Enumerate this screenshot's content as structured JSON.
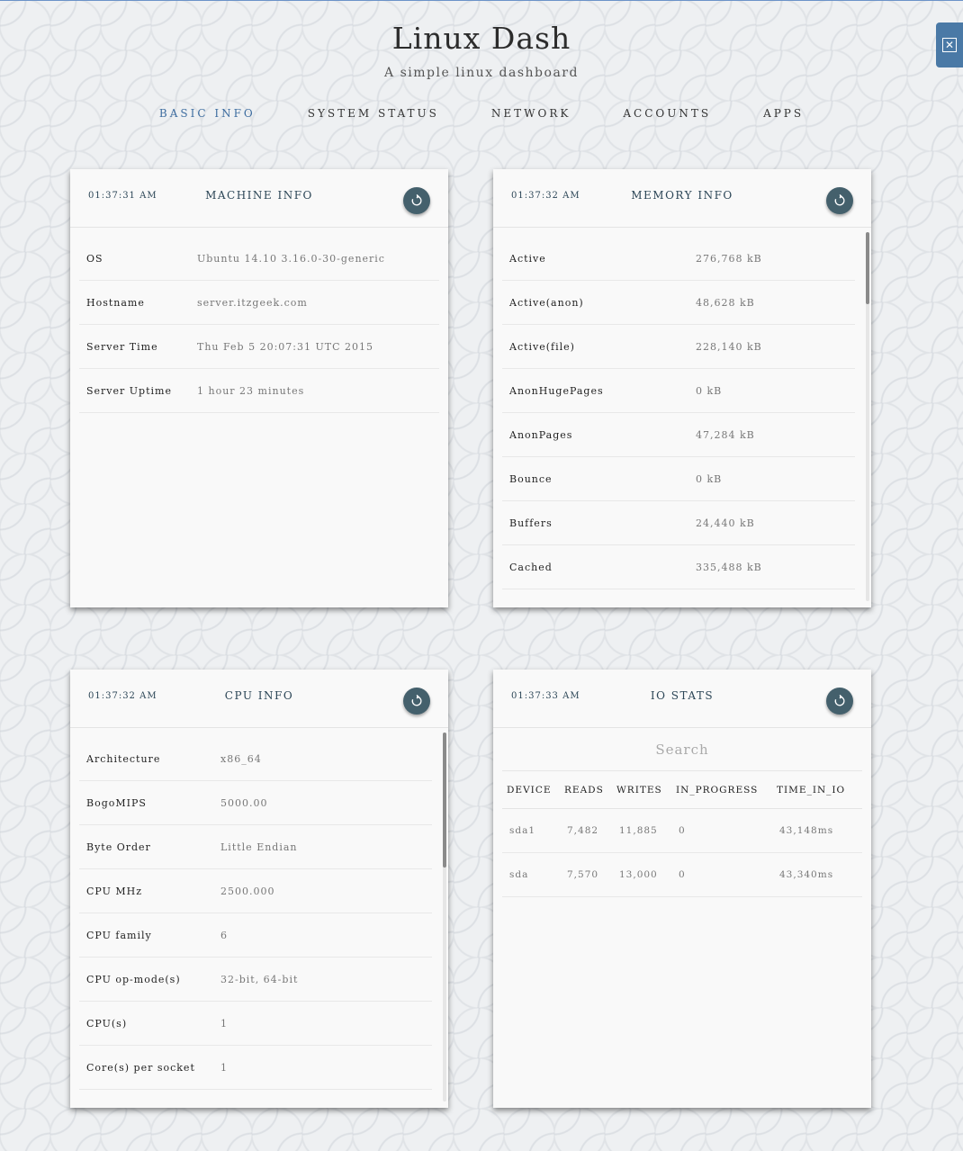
{
  "header": {
    "title": "Linux Dash",
    "subtitle": "A simple linux dashboard"
  },
  "nav": [
    {
      "label": "BASIC INFO",
      "active": true
    },
    {
      "label": "SYSTEM STATUS",
      "active": false
    },
    {
      "label": "NETWORK",
      "active": false
    },
    {
      "label": "ACCOUNTS",
      "active": false
    },
    {
      "label": "APPS",
      "active": false
    }
  ],
  "close_tab": {
    "icon": "close-icon",
    "glyph": "✕"
  },
  "colors": {
    "accent": "#3e6da0",
    "refresh_button": "#44606c",
    "close_tab": "#4a79a6"
  },
  "machine_info": {
    "time": "01:37:31 AM",
    "title": "MACHINE INFO",
    "refresh_icon": "refresh-icon",
    "rows": [
      {
        "key": "OS",
        "value": "Ubuntu 14.10 3.16.0-30-generic"
      },
      {
        "key": "Hostname",
        "value": "server.itzgeek.com"
      },
      {
        "key": "Server Time",
        "value": "Thu Feb 5 20:07:31 UTC 2015"
      },
      {
        "key": "Server Uptime",
        "value": "1 hour 23 minutes"
      }
    ]
  },
  "memory_info": {
    "time": "01:37:32 AM",
    "title": "MEMORY INFO",
    "refresh_icon": "refresh-icon",
    "rows": [
      {
        "key": "Active",
        "value": "276,768 kB"
      },
      {
        "key": "Active(anon)",
        "value": "48,628 kB"
      },
      {
        "key": "Active(file)",
        "value": "228,140 kB"
      },
      {
        "key": "AnonHugePages",
        "value": "0 kB"
      },
      {
        "key": "AnonPages",
        "value": "47,284 kB"
      },
      {
        "key": "Bounce",
        "value": "0 kB"
      },
      {
        "key": "Buffers",
        "value": "24,440 kB"
      },
      {
        "key": "Cached",
        "value": "335,488 kB"
      }
    ]
  },
  "cpu_info": {
    "time": "01:37:32 AM",
    "title": "CPU INFO",
    "refresh_icon": "refresh-icon",
    "rows": [
      {
        "key": "Architecture",
        "value": "x86_64"
      },
      {
        "key": "BogoMIPS",
        "value": "5000.00"
      },
      {
        "key": "Byte Order",
        "value": "Little Endian"
      },
      {
        "key": "CPU MHz",
        "value": "2500.000"
      },
      {
        "key": "CPU family",
        "value": "6"
      },
      {
        "key": "CPU op-mode(s)",
        "value": "32-bit, 64-bit"
      },
      {
        "key": "CPU(s)",
        "value": "1"
      },
      {
        "key": "Core(s) per socket",
        "value": "1"
      }
    ]
  },
  "io_stats": {
    "time": "01:37:33 AM",
    "title": "IO STATS",
    "refresh_icon": "refresh-icon",
    "search_placeholder": "Search",
    "columns": [
      "DEVICE",
      "READS",
      "WRITES",
      "IN_PROGRESS",
      "TIME_IN_IO"
    ],
    "rows": [
      [
        "sda1",
        "7,482",
        "11,885",
        "0",
        "43,148ms"
      ],
      [
        "sda",
        "7,570",
        "13,000",
        "0",
        "43,340ms"
      ]
    ]
  }
}
